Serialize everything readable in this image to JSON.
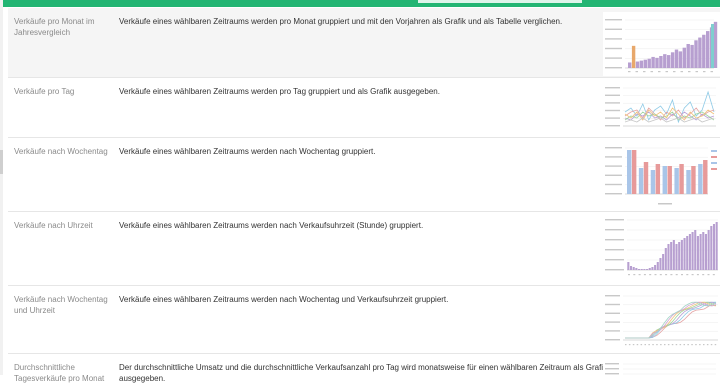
{
  "reports": [
    {
      "name": "Verkäufe pro Monat im Jahresvergleich",
      "description": "Verkäufe eines wählbaren Zeitraums werden pro Monat gruppiert und mit den Vorjahren als Grafik und als Tabelle verglichen.",
      "thumbnail": "grouped-bar-chart-thumbnail"
    },
    {
      "name": "Verkäufe pro Tag",
      "description": "Verkäufe eines wählbaren Zeitraums werden pro Tag gruppiert und als Grafik ausgegeben.",
      "thumbnail": "multi-line-chart-thumbnail"
    },
    {
      "name": "Verkäufe nach Wochentag",
      "description": "Verkäufe eines wählbaren Zeitraums werden nach Wochentag gruppiert.",
      "thumbnail": "weekday-bar-chart-thumbnail"
    },
    {
      "name": "Verkäufe nach Uhrzeit",
      "description": "Verkäufe eines wählbaren Zeitraums werden nach Verkaufsuhrzeit (Stunde) gruppiert.",
      "thumbnail": "hourly-bar-chart-thumbnail"
    },
    {
      "name": "Verkäufe nach Wochentag und Uhrzeit",
      "description": "Verkäufe eines wählbaren Zeitraums werden nach Wochentag und Verkaufsuhrzeit gruppiert.",
      "thumbnail": "weekday-hour-line-chart-thumbnail"
    },
    {
      "name": "Durchschnittliche Tagesverkäufe pro Monat",
      "description": "Der durchschnittliche Umsatz und die durchschnittliche Verkaufsanzahl pro Tag wird monatsweise für einen wählbaren Zeitraum als Grafik ausgegeben.",
      "thumbnail": "average-chart-thumbnail"
    }
  ],
  "colors": {
    "accent": "#22b573",
    "row_highlight": "#f5f5f5",
    "bar_purple": "#b79fd0",
    "bar_orange": "#e8a86b",
    "bar_blue": "#a9c5e8",
    "bar_red": "#e79a9a",
    "bar_teal": "#7fcfcf"
  }
}
